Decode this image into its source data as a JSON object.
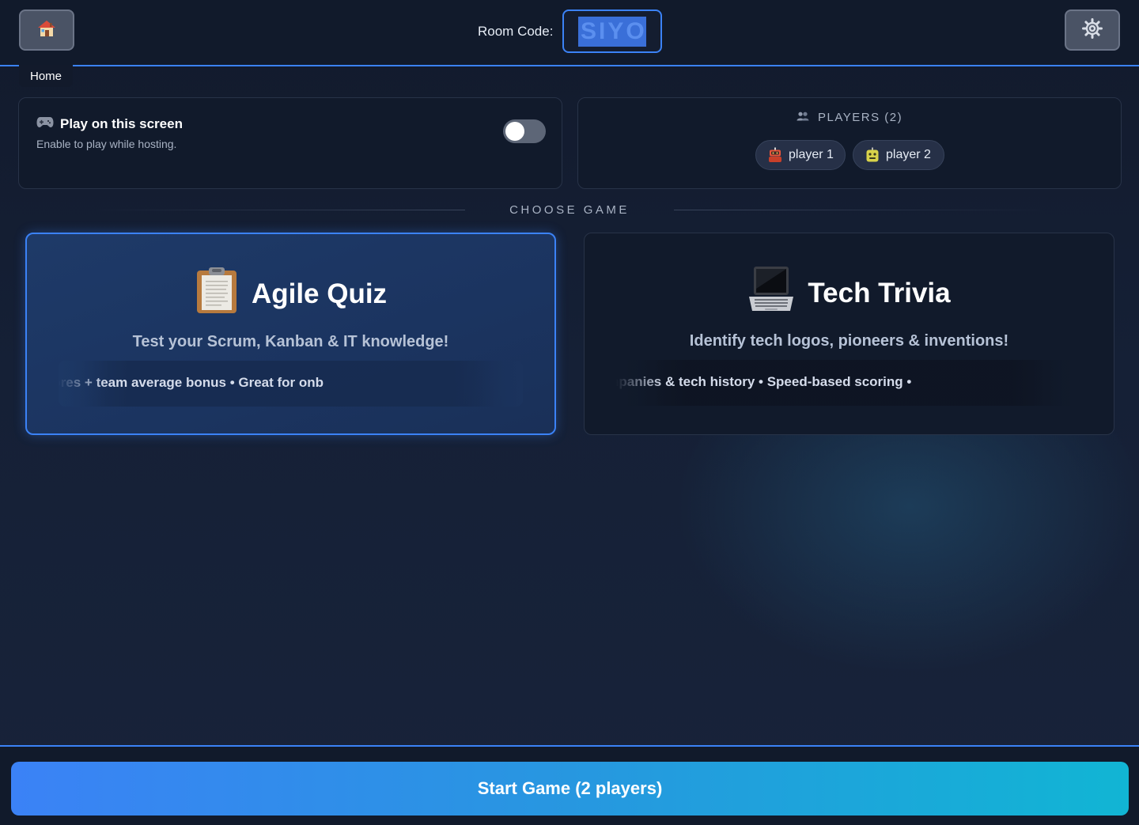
{
  "header": {
    "home_tooltip": "Home",
    "room_code_label": "Room Code:",
    "room_code": "SIYO"
  },
  "local_play": {
    "icon": "gamepad-icon",
    "title": "Play on this screen",
    "subtitle": "Enable to play while hosting.",
    "enabled": false
  },
  "players": {
    "heading": "PLAYERS (2)",
    "list": [
      {
        "name": "player 1",
        "avatar": "red-robot-icon"
      },
      {
        "name": "player 2",
        "avatar": "yellow-robot-icon"
      }
    ]
  },
  "choose_game": {
    "label": "CHOOSE GAME"
  },
  "games": [
    {
      "icon": "clipboard-icon",
      "title": "Agile Quiz",
      "description": "Test your Scrum, Kanban & IT knowledge!",
      "details": "ss questions • Individual scores + team average bonus • Great for onb",
      "selected": true
    },
    {
      "icon": "laptop-icon",
      "title": "Tech Trivia",
      "description": "Identify tech logos, pioneers & inventions!",
      "details": "amming languages, companies & tech history • Speed-based scoring •",
      "selected": false
    }
  ],
  "footer": {
    "start_label": "Start Game (2 players)"
  },
  "colors": {
    "accent": "#3b82f6",
    "background": "#131c2e",
    "panel": "#111a2b",
    "start_gradient_end": "#11b5d4"
  }
}
